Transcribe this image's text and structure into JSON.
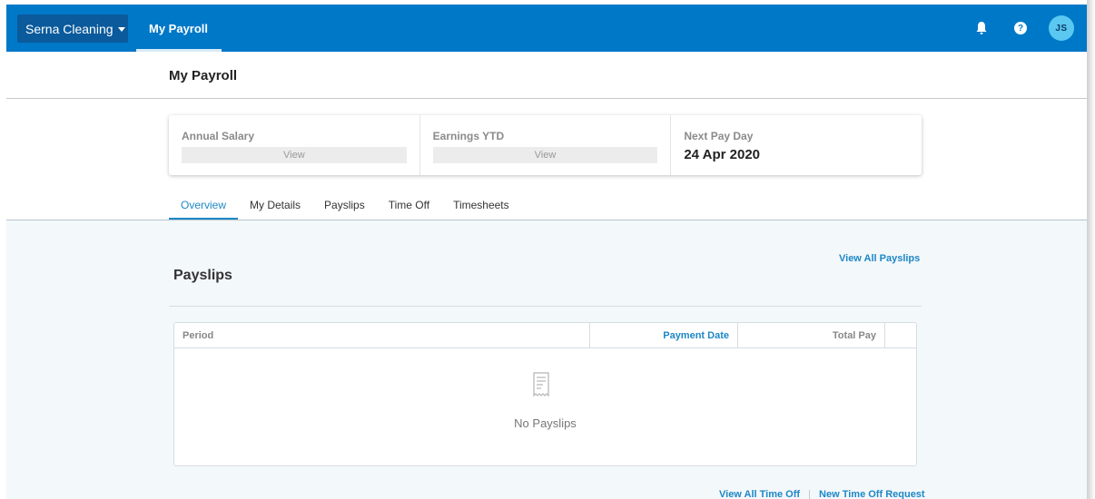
{
  "header": {
    "org_name": "Serna Cleaning",
    "nav_label": "My Payroll",
    "help_symbol": "?",
    "avatar_initials": "JS",
    "brand_color": "#0078c8"
  },
  "page": {
    "title": "My Payroll"
  },
  "stats": [
    {
      "label": "Annual Salary",
      "value": "View"
    },
    {
      "label": "Earnings YTD",
      "value": "View"
    },
    {
      "label": "Next Pay Day",
      "value": "24 Apr 2020"
    }
  ],
  "tabs": [
    {
      "label": "Overview",
      "active": true
    },
    {
      "label": "My Details",
      "active": false
    },
    {
      "label": "Payslips",
      "active": false
    },
    {
      "label": "Time Off",
      "active": false
    },
    {
      "label": "Timesheets",
      "active": false
    }
  ],
  "payslips": {
    "heading": "Payslips",
    "view_all_label": "View All Payslips",
    "columns": [
      "Period",
      "Payment Date",
      "Total Pay"
    ],
    "empty_icon": "receipt-icon",
    "empty_text": "No Payslips"
  },
  "time_off": {
    "view_all_label": "View All Time Off",
    "new_request_label": "New Time Off Request"
  },
  "icons": {
    "bell": "bell-icon",
    "help": "help-icon",
    "caret": "caret-down-icon"
  },
  "accent_color": "#1e87c6"
}
